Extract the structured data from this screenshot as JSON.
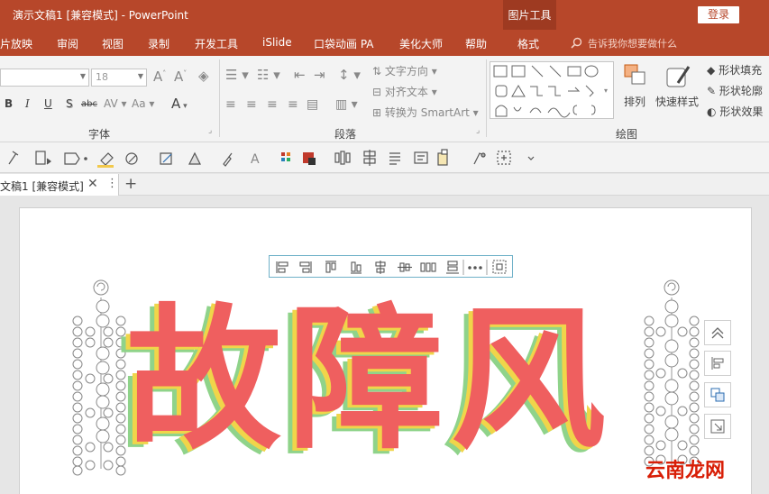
{
  "window": {
    "title": "演示文稿1 [兼容模式] - PowerPoint",
    "context_label": "图片工具",
    "login_label": "登录"
  },
  "tabs": [
    {
      "label": "片放映"
    },
    {
      "label": "审阅"
    },
    {
      "label": "视图"
    },
    {
      "label": "录制"
    },
    {
      "label": "开发工具"
    },
    {
      "label": "iSlide"
    },
    {
      "label": "口袋动画 PA"
    },
    {
      "label": "美化大师"
    },
    {
      "label": "帮助"
    },
    {
      "label": "格式"
    }
  ],
  "tell_me": "告诉我你想要做什么",
  "ribbon": {
    "font_size": "18",
    "font_group": "字体",
    "paragraph_group": "段落",
    "drawing_group": "绘图",
    "text_direction": "文字方向",
    "align_text": "对齐文本",
    "convert_smartart": "转换为 SmartArt",
    "arrange": "排列",
    "quick_styles": "快速样式",
    "shape_fill": "形状填充",
    "shape_outline": "形状轮廓",
    "shape_effects": "形状效果",
    "bold": "B",
    "italic": "I",
    "underline": "U",
    "shadow": "S",
    "strike": "abc",
    "case": "Aa",
    "font_color": "A"
  },
  "document_tab": {
    "label": "文稿1 [兼容模式]",
    "close": "✕",
    "menu": "⋮",
    "new": "+"
  },
  "slide": {
    "text": "故障风"
  },
  "watermark": "云南龙网",
  "colors": {
    "accent": "#b7472a",
    "glitch_red": "#ef5f5f",
    "glitch_yellow": "#f0d54a",
    "glitch_green": "#8fd38a"
  }
}
